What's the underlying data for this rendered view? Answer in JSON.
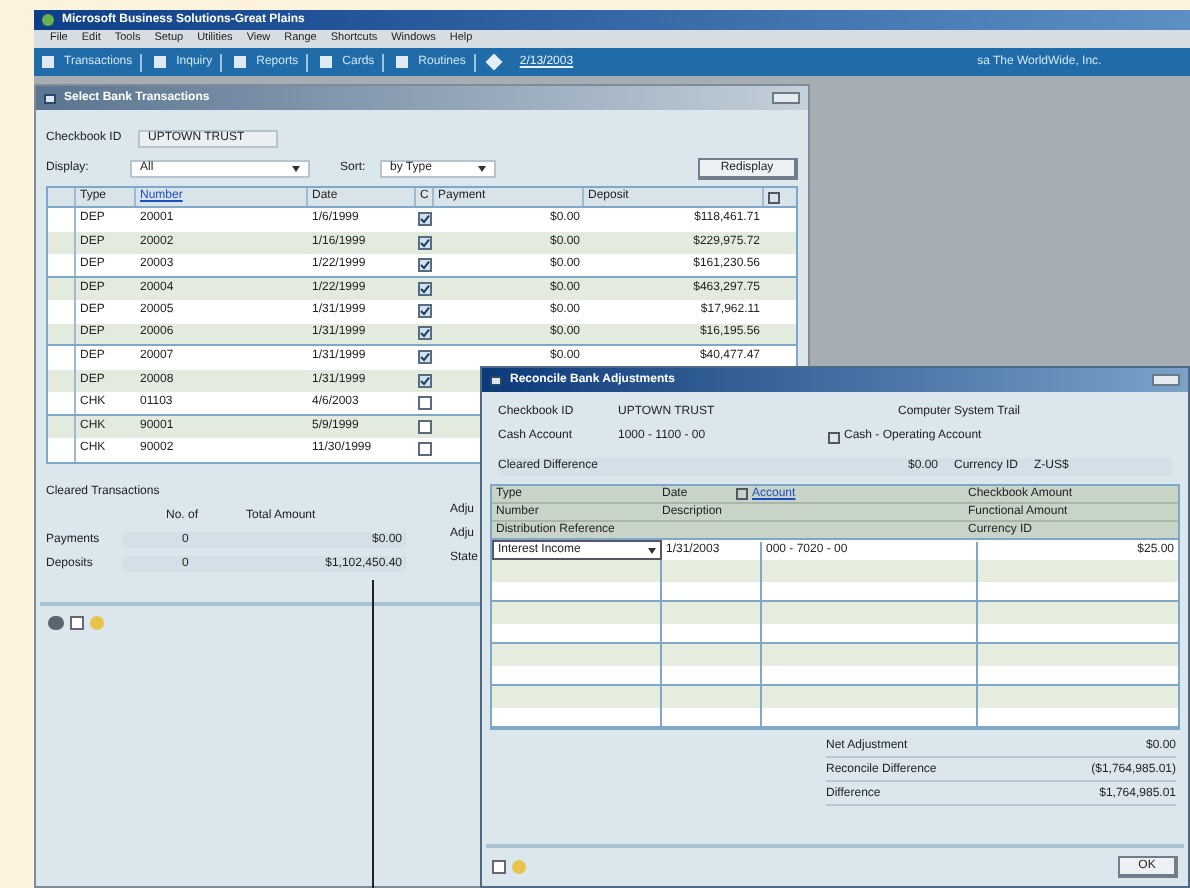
{
  "app": {
    "title": "Microsoft Business Solutions-Great Plains",
    "menu": [
      "File",
      "Edit",
      "Tools",
      "Setup",
      "Utilities",
      "View",
      "Range",
      "Shortcuts",
      "Windows",
      "Help"
    ],
    "toolbar": [
      {
        "label": "Transactions"
      },
      {
        "label": "Inquiry"
      },
      {
        "label": "Reports"
      },
      {
        "label": "Cards"
      },
      {
        "label": "Routines"
      }
    ],
    "date": "2/13/2003",
    "company": "sa  The WorldWide, Inc."
  },
  "select_window": {
    "title": "Select Bank Transactions",
    "checkbook_label": "Checkbook ID",
    "checkbook_value": "UPTOWN TRUST",
    "display_label": "Display:",
    "display_value": "All",
    "sort_label": "Sort:",
    "sort_value": "by Type",
    "redisplay": "Redisplay",
    "columns": [
      "Type",
      "Number",
      "Date",
      "C",
      "Payment",
      "Deposit"
    ],
    "rows": [
      {
        "type": "DEP",
        "number": "20001",
        "date": "1/6/1999",
        "cleared": true,
        "payment": "$0.00",
        "deposit": "$118,461.71"
      },
      {
        "type": "DEP",
        "number": "20002",
        "date": "1/16/1999",
        "cleared": true,
        "payment": "$0.00",
        "deposit": "$229,975.72"
      },
      {
        "type": "DEP",
        "number": "20003",
        "date": "1/22/1999",
        "cleared": true,
        "payment": "$0.00",
        "deposit": "$161,230.56"
      },
      {
        "type": "DEP",
        "number": "20004",
        "date": "1/22/1999",
        "cleared": true,
        "payment": "$0.00",
        "deposit": "$463,297.75"
      },
      {
        "type": "DEP",
        "number": "20005",
        "date": "1/31/1999",
        "cleared": true,
        "payment": "$0.00",
        "deposit": "$17,962.11"
      },
      {
        "type": "DEP",
        "number": "20006",
        "date": "1/31/1999",
        "cleared": true,
        "payment": "$0.00",
        "deposit": "$16,195.56"
      },
      {
        "type": "DEP",
        "number": "20007",
        "date": "1/31/1999",
        "cleared": true,
        "payment": "$0.00",
        "deposit": "$40,477.47"
      },
      {
        "type": "DEP",
        "number": "20008",
        "date": "1/31/1999",
        "cleared": true
      },
      {
        "type": "CHK",
        "number": "01103",
        "date": "4/6/2003",
        "cleared": false
      },
      {
        "type": "CHK",
        "number": "90001",
        "date": "5/9/1999",
        "cleared": false
      },
      {
        "type": "CHK",
        "number": "90002",
        "date": "11/30/1999",
        "cleared": false
      }
    ],
    "cleared_title": "Cleared Transactions",
    "count_header": "No. of",
    "total_header": "Total Amount",
    "totals": [
      {
        "label": "Payments",
        "count": "0",
        "amount": "$0.00"
      },
      {
        "label": "Deposits",
        "count": "0",
        "amount": "$1,102,450.40"
      }
    ],
    "side_labels": [
      "Adju",
      "Adju",
      "State"
    ]
  },
  "adjust_dialog": {
    "title": "Reconcile Bank Adjustments",
    "checkbook_label": "Checkbook ID",
    "checkbook_value": "UPTOWN TRUST",
    "trail": "Computer System Trail",
    "cash_label": "Cash Account",
    "cash_value": "1000 - 1100 - 00",
    "cash_desc": "Cash - Operating Account",
    "cleared_label": "Cleared Difference",
    "cleared_value": "$0.00",
    "currency_label": "Currency ID",
    "currency_value": "Z-US$",
    "header": {
      "type": "Type",
      "date": "Date",
      "account": "Account",
      "checkbook_amount": "Checkbook Amount",
      "number": "Number",
      "description": "Description",
      "functional_amount": "Functional Amount",
      "reference": "Distribution Reference",
      "currency": "Currency ID"
    },
    "entry": {
      "type": "Interest Income",
      "date": "1/31/2003",
      "account": "000 - 7020 - 00",
      "amount": "$25.00"
    },
    "summary": [
      {
        "label": "Net Adjustment",
        "value": "$0.00"
      },
      {
        "label": "Reconcile Difference",
        "value": "($1,764,985.01)"
      },
      {
        "label": "Difference",
        "value": "$1,764,985.01"
      }
    ],
    "ok": "OK"
  }
}
